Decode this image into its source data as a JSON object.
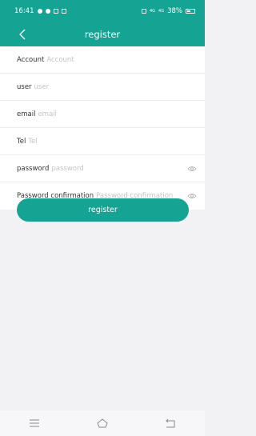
{
  "status_bar": {
    "time": "16:41",
    "network_1": "4G",
    "network_2": "4G",
    "battery": "38%"
  },
  "header": {
    "title": "register",
    "back_icon": "chevron-left-icon"
  },
  "form": {
    "account": {
      "label": "Account",
      "placeholder": "Account"
    },
    "user": {
      "label": "user",
      "placeholder": "user"
    },
    "email": {
      "label": "email",
      "placeholder": "email"
    },
    "tel": {
      "label": "Tel",
      "placeholder": "Tel"
    },
    "password": {
      "label": "password",
      "placeholder": "password",
      "icon": "eye-icon"
    },
    "password_confirmation": {
      "label": "Password confirmation",
      "placeholder": "Password confirmation",
      "icon": "eye-icon"
    }
  },
  "register_button": {
    "label": "register"
  },
  "nav_bar": {
    "menu_icon": "menu-icon",
    "home_icon": "home-icon",
    "back_icon": "back-icon"
  },
  "colors": {
    "accent": "#15a394",
    "background": "#f2f2f5",
    "placeholder": "#c4c4c4"
  }
}
